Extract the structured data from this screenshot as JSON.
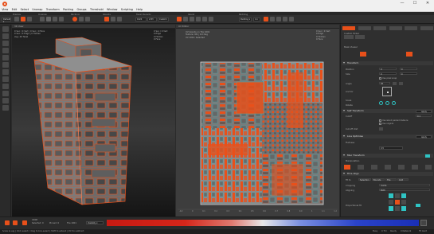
{
  "window": {
    "title": "",
    "controls": [
      "—",
      "☐",
      "✕"
    ]
  },
  "menu": [
    "View",
    "Edit",
    "Select",
    "Unwrap",
    "Transform",
    "Packing",
    "Groups",
    "Threshold",
    "Window",
    "Scripting",
    "Help"
  ],
  "toolbar": {
    "section_labels": [
      "Display",
      "Unwrap",
      "Packing",
      "Islands",
      "Texel Density",
      "Island"
    ],
    "select_mode": "Default ▾",
    "density_value": "1024",
    "texel_value": "2.83",
    "units": "Custom",
    "padding_label": "Padding",
    "padding_value": "Padding ▾",
    "pixel_value": "4 ▾"
  },
  "viewport3d": {
    "header": "3D View",
    "stats": [
      "0 Sel. / 0 Vert  |  0 Sel. / 0 Face",
      "0 Sel. / 0 Edge  |  0 Hidden",
      "Avg: 4K Texel"
    ],
    "stats_right": [
      "0 Sel. / 0 Vert",
      "0 Edge",
      "0 Hidden",
      "0 Face"
    ]
  },
  "viewportuv": {
    "header": "UV Editor",
    "info": [
      "UV Islands on Tile 1001",
      "Texture: ON  |  0.0 Deg",
      "UV 1001: Selected"
    ],
    "stats_right": [
      "0 Sel. / 0 Vert",
      "0 Edge",
      "0 Hidden",
      "0 Face"
    ],
    "ruler_ticks": [
      "-0.2",
      "0",
      "0.1",
      "0.2",
      "0.3",
      "0.4",
      "0.5",
      "0.6",
      "0.7",
      "0.8",
      "0.9",
      "1",
      "1.1",
      "1.2"
    ],
    "zoom_readout": "1:1"
  },
  "right_panel": {
    "tabs": [
      "Tools",
      "UV",
      "Pack",
      "Sel",
      "Tex",
      "Misc"
    ],
    "custom_picker": "Custom Picker",
    "mask_label": "Mask Viewer",
    "sections": {
      "transform": "Transform",
      "self_transform": "Self Transform",
      "line_optimise": "Line Optimise",
      "misc_transform": "Misc Transform",
      "fit_align": "Fit & Align"
    },
    "transform": {
      "position_label": "Position",
      "pos_u": "0",
      "pos_v": "0",
      "size_label": "Size",
      "size_u": "0",
      "size_v": "0",
      "use_aspect": "Use pixel snap",
      "angle_label": "Angle",
      "angle_value": "90",
      "anchor_label": "Anchor",
      "scale_label": "Scale",
      "rotate_label": "Rotate"
    },
    "self_transform": {
      "label": "Cutoff",
      "value": "0.1",
      "option1": "Use island packed distance",
      "option2": "Use original",
      "cut_label": "Cut off Unit",
      "button": "Apply"
    },
    "line_optimise": {
      "label": "Flatness",
      "value": "0.5",
      "button": "Apply"
    },
    "misc_transform": {
      "manip_label": "Manipulation"
    },
    "fit_align": {
      "fit_label": "Fit to",
      "fit_options": [
        "Selection",
        "Bounds",
        "Tile",
        "Grid"
      ],
      "cropping_label": "Cropping",
      "cropping_value": "Inside",
      "aligning_label": "Aligning",
      "aligning_value": "Both",
      "prop_label": "Proportional fit"
    }
  },
  "bottom": {
    "udim_label": "UDIM",
    "selected_label": "Selected: 0",
    "pinned_label": "Pinned: 0",
    "tile_label": "Tile 1001",
    "dropdown": "Visibility ▾"
  },
  "status": {
    "left": "Scale & Lag  |  Click select / drag to box-select  |  Shift to extend  |  Ctrl to subtract",
    "right_items": [
      "Busy",
      "0 Thr",
      "Ready",
      "0 Network",
      "Fit Alert"
    ]
  },
  "colors": {
    "accent": "#e8501a",
    "uv_edge": "#2fc4c4",
    "panel_bg": "#2f2f2f"
  }
}
